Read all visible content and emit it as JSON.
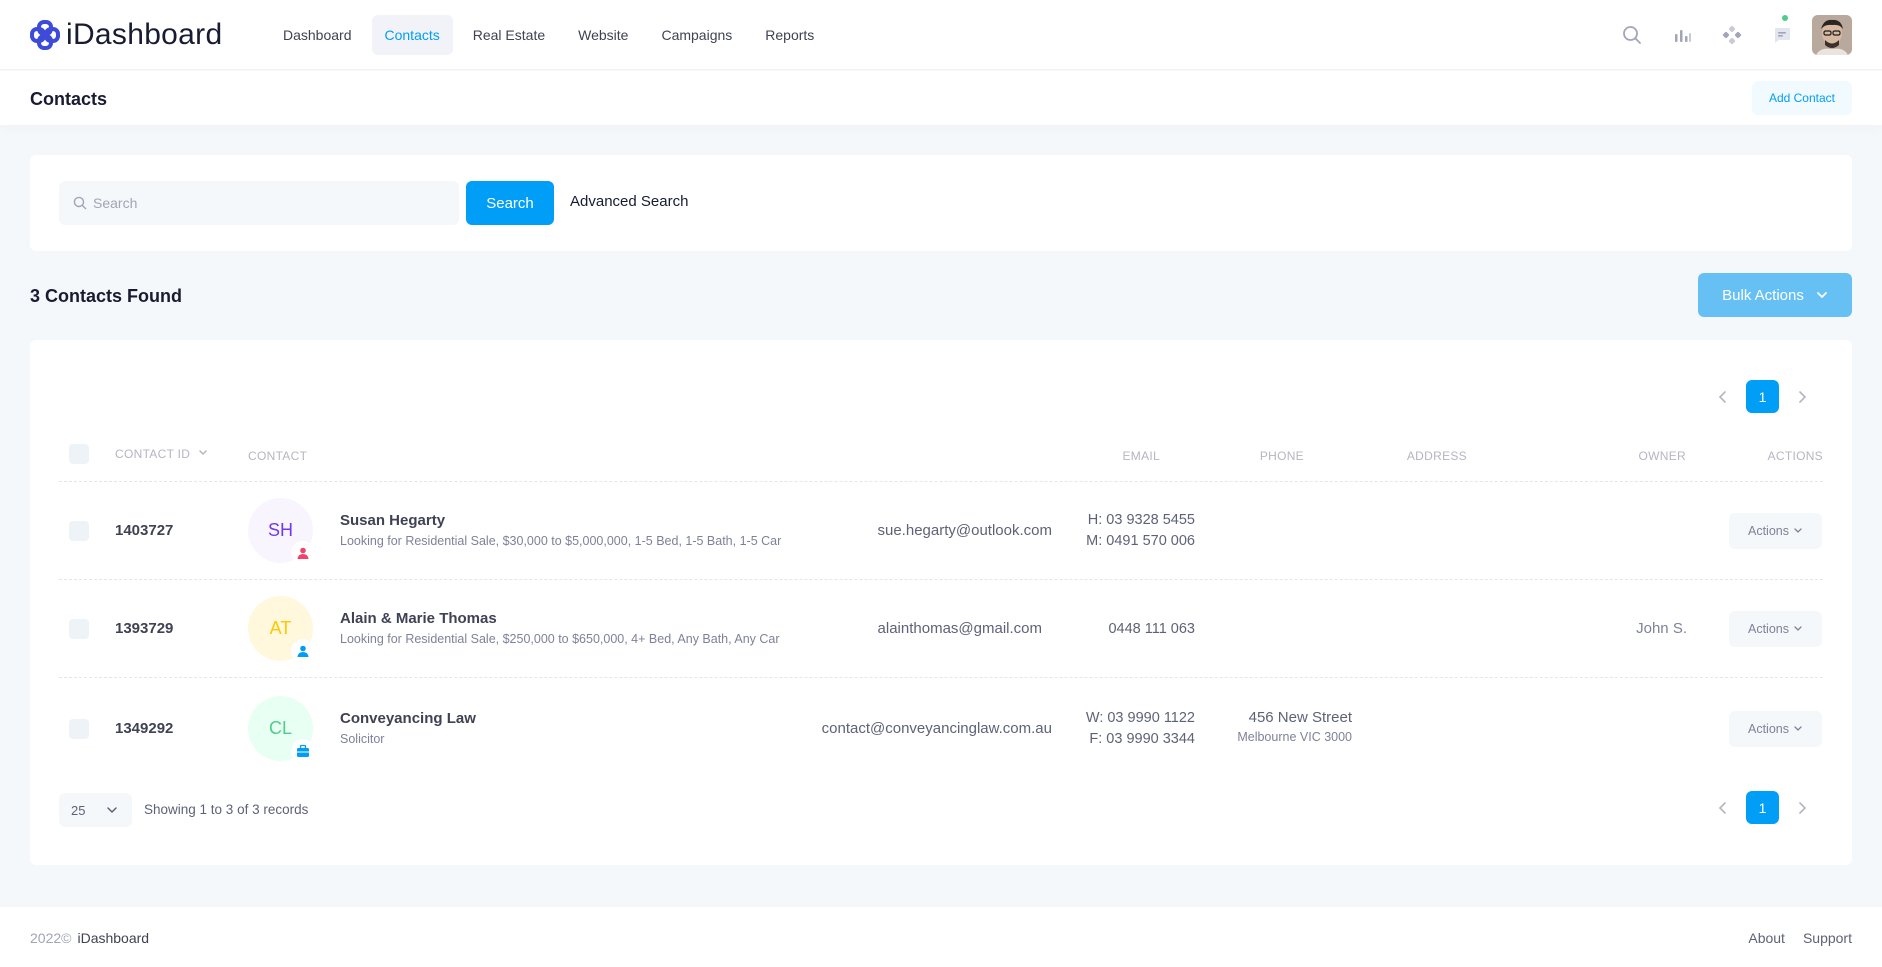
{
  "app": {
    "name": "iDashboard",
    "accent": "#009ef7"
  },
  "nav": [
    {
      "label": "Dashboard",
      "active": false
    },
    {
      "label": "Contacts",
      "active": true
    },
    {
      "label": "Real Estate",
      "active": false
    },
    {
      "label": "Website",
      "active": false
    },
    {
      "label": "Campaigns",
      "active": false
    },
    {
      "label": "Reports",
      "active": false
    }
  ],
  "header_icons": [
    "search-icon",
    "bar-chart-icon",
    "grid-icon",
    "chat-icon"
  ],
  "toolbar": {
    "title": "Contacts",
    "add_label": "Add Contact"
  },
  "search": {
    "placeholder": "Search",
    "value": "",
    "button_label": "Search",
    "advanced_label": "Advanced Search"
  },
  "results": {
    "found_text": "3 Contacts Found",
    "bulk_label": "Bulk Actions"
  },
  "pagination": {
    "current_page": "1"
  },
  "table": {
    "headers": {
      "contact_id": "CONTACT ID",
      "contact": "CONTACT",
      "email": "EMAIL",
      "phone": "PHONE",
      "address": "ADDRESS",
      "owner": "OWNER",
      "actions": "ACTIONS"
    },
    "rows": [
      {
        "id": "1403727",
        "initials": "SH",
        "avatar_bg": "#f8f5ff",
        "avatar_color": "#7239ea",
        "badge_icon": "person-icon",
        "badge_color": "#f1416c",
        "name": "Susan Hegarty",
        "desc": "Looking for Residential Sale, $30,000 to $5,000,000, 1-5 Bed, 1-5 Bath, 1-5 Car",
        "email": "sue.hegarty@outlook.com",
        "phone1": "H: 03 9328 5455",
        "phone2": "M: 0491 570 006",
        "addr1": "",
        "addr2": "",
        "owner": "",
        "action_label": "Actions"
      },
      {
        "id": "1393729",
        "initials": "AT",
        "avatar_bg": "#fff8dd",
        "avatar_color": "#ffc700",
        "badge_icon": "person-icon",
        "badge_color": "#009ef7",
        "name": "Alain & Marie Thomas",
        "desc": "Looking for Residential Sale, $250,000 to $650,000, 4+ Bed, Any Bath, Any Car",
        "email": "alainthomas@gmail.com",
        "phone1": "0448 111 063",
        "phone2": "",
        "addr1": "",
        "addr2": "",
        "owner": "John S.",
        "action_label": "Actions"
      },
      {
        "id": "1349292",
        "initials": "CL",
        "avatar_bg": "#e8fff3",
        "avatar_color": "#50cd89",
        "badge_icon": "briefcase-icon",
        "badge_color": "#009ef7",
        "name": "Conveyancing Law",
        "desc": "Solicitor",
        "email": "contact@conveyancinglaw.com.au",
        "phone1": "W: 03 9990 1122",
        "phone2": "F: 03 9990 3344",
        "addr1": "456 New Street",
        "addr2": "Melbourne VIC 3000",
        "owner": "",
        "action_label": "Actions"
      }
    ]
  },
  "footer_table": {
    "page_size": "25",
    "showing_text": "Showing 1 to 3 of 3 records"
  },
  "footer": {
    "year": "2022©",
    "brand": "iDashboard",
    "links": [
      "About",
      "Support"
    ]
  }
}
